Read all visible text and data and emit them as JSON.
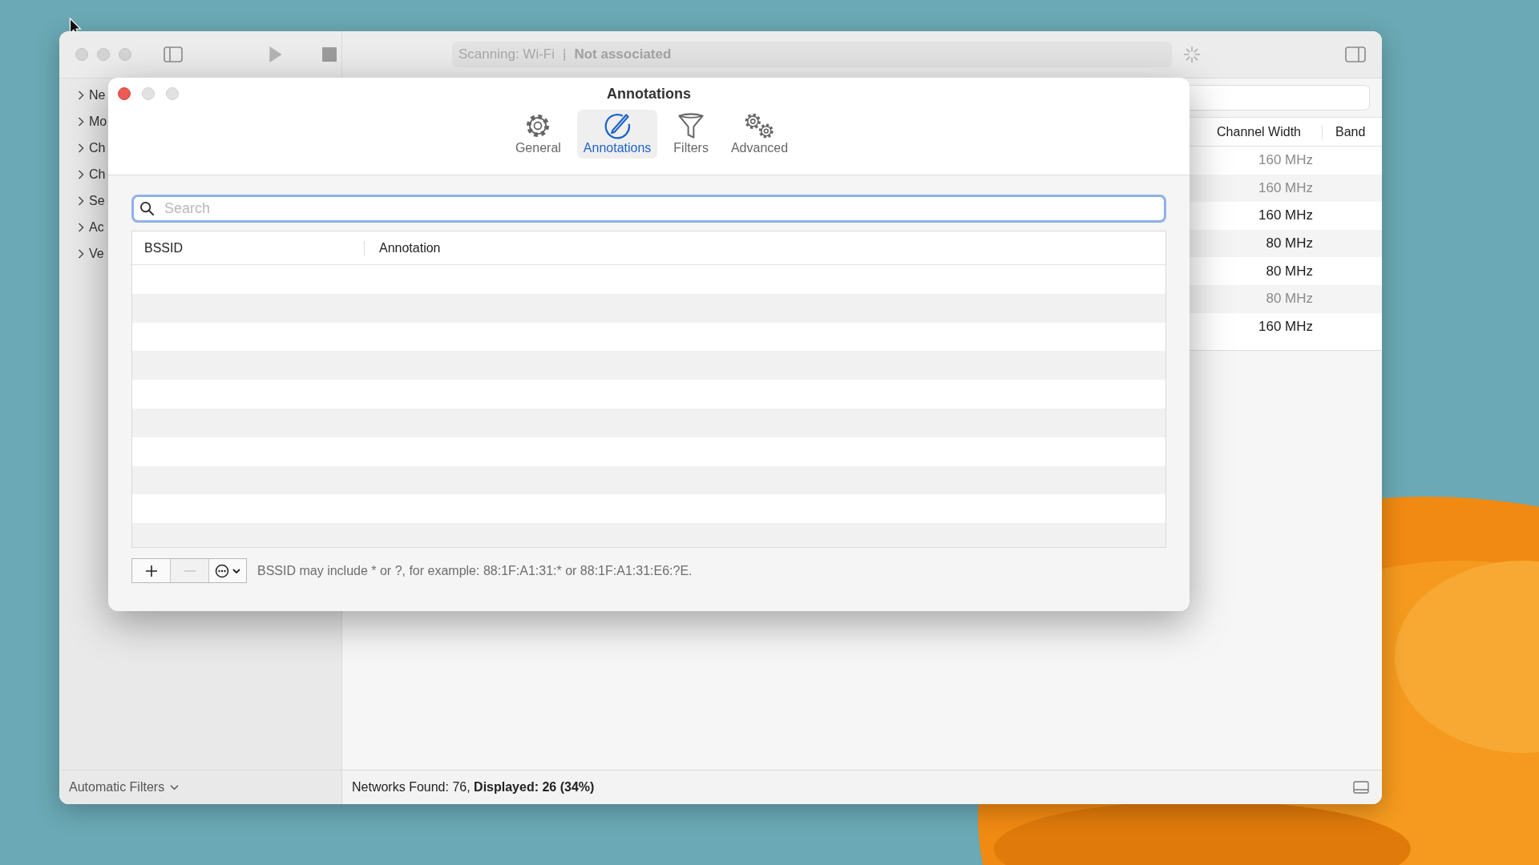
{
  "main_window": {
    "toolbar": {
      "status_text": "Scanning: Wi-Fi",
      "status_separator": "|",
      "status_detail": "Not associated"
    },
    "sidebar": {
      "items": [
        {
          "label": "Ne"
        },
        {
          "label": "Mo"
        },
        {
          "label": "Ch"
        },
        {
          "label": "Ch"
        },
        {
          "label": "Se"
        },
        {
          "label": "Ac"
        },
        {
          "label": "Ve"
        }
      ],
      "footer": "Automatic Filters"
    },
    "table": {
      "columns": [
        "Channel Width",
        "Band"
      ],
      "rows": [
        {
          "channel_width": "160 MHz",
          "dimmed": true
        },
        {
          "channel_width": "160 MHz",
          "dimmed": true
        },
        {
          "channel_width": "160 MHz",
          "dimmed": false
        },
        {
          "channel_width": "80 MHz",
          "dimmed": false
        },
        {
          "channel_width": "80 MHz",
          "dimmed": false
        },
        {
          "channel_width": "80 MHz",
          "dimmed": true
        },
        {
          "channel_width": "160 MHz",
          "dimmed": false
        }
      ]
    },
    "status_bar": "Networks Found: 76, **Displayed: 26 (34%)**"
  },
  "dialog": {
    "title": "Annotations",
    "tabs": [
      {
        "kind": "general",
        "label": "General",
        "selected": false
      },
      {
        "kind": "annotations",
        "label": "Annotations",
        "selected": true
      },
      {
        "kind": "filters",
        "label": "Filters",
        "selected": false
      },
      {
        "kind": "advanced",
        "label": "Advanced",
        "selected": false
      }
    ],
    "search": {
      "placeholder": "Search"
    },
    "table": {
      "columns": [
        "BSSID",
        "Annotation"
      ]
    },
    "buttons": [
      {
        "kind": "add",
        "disabled": false
      },
      {
        "kind": "remove",
        "disabled": true
      },
      {
        "kind": "action",
        "disabled": false
      }
    ],
    "hint": "BSSID may include * or ?, for example: 88:1F:A1:31:* or 88:1F:A1:31:E6:?E."
  }
}
